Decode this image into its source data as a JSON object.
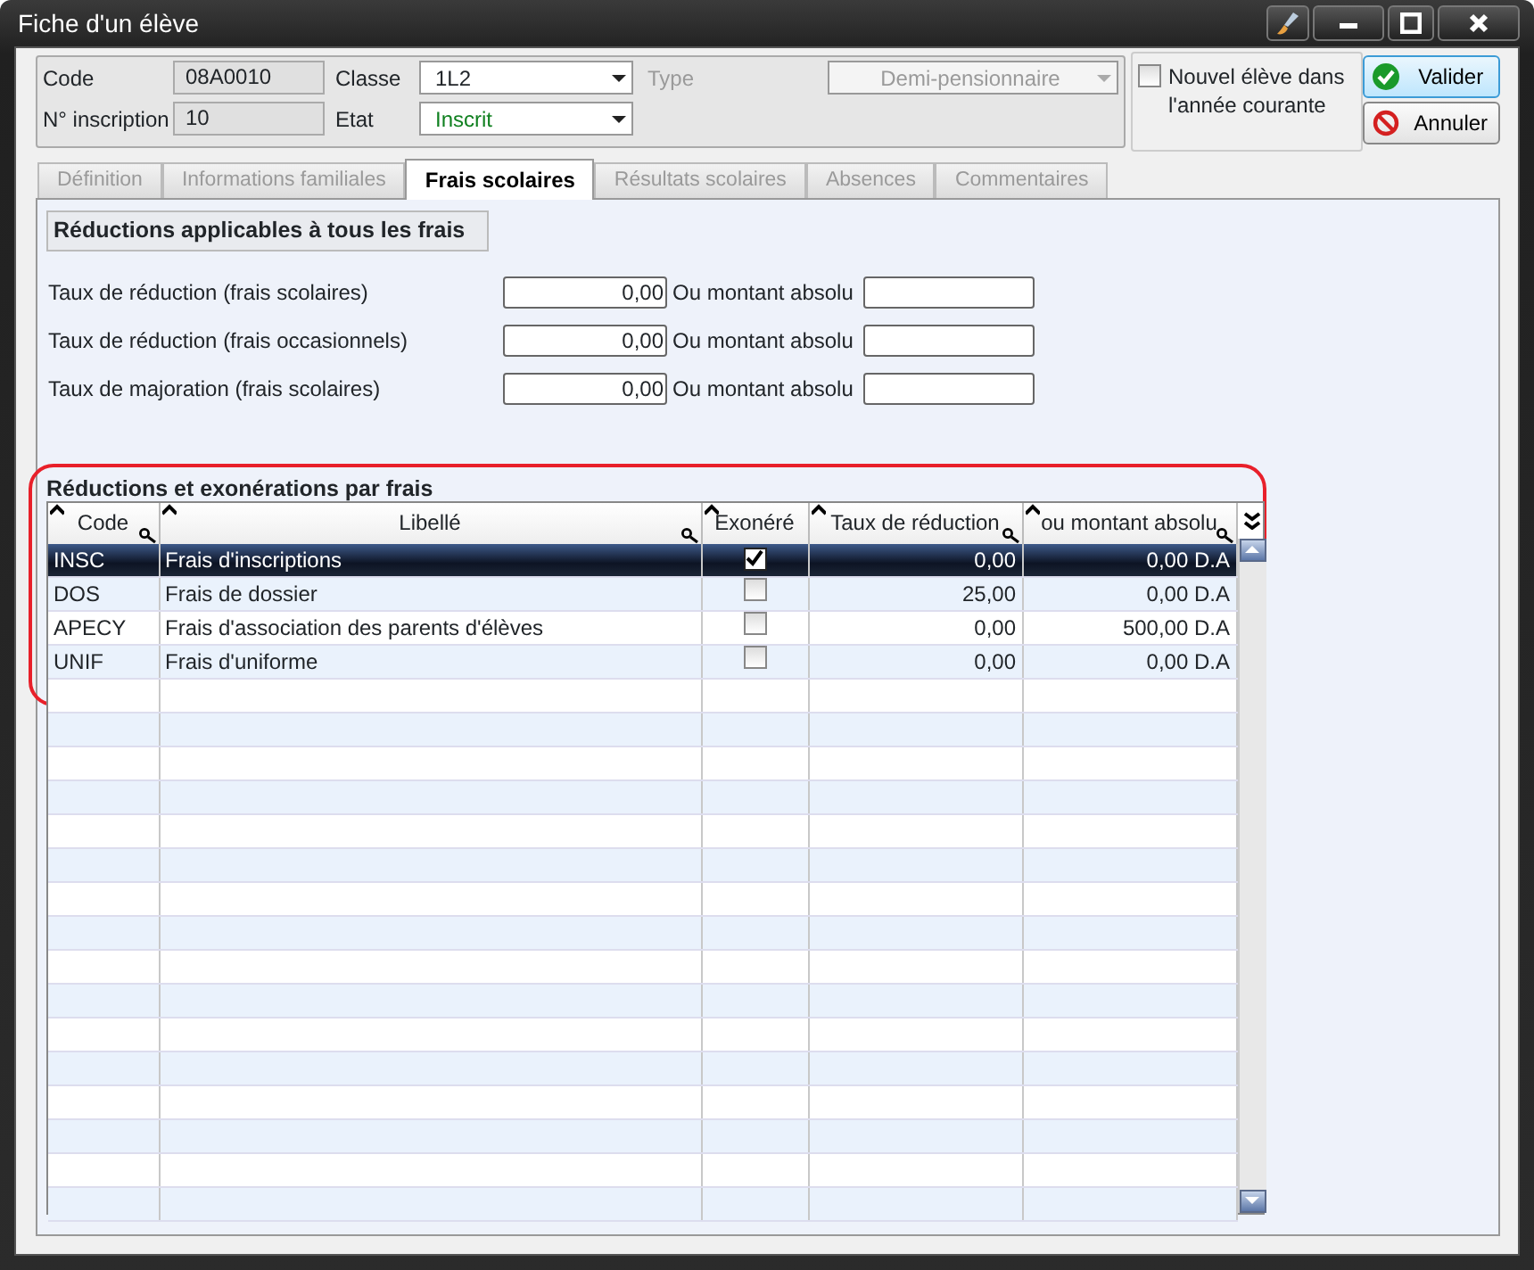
{
  "window": {
    "title": "Fiche d'un élève"
  },
  "header": {
    "code_label": "Code",
    "code": "08A0010",
    "inscription_label": "N° inscription",
    "inscription": "10",
    "classe_label": "Classe",
    "classe": "1L2",
    "etat_label": "Etat",
    "etat": "Inscrit",
    "type_label": "Type",
    "type": "Demi-pensionnaire",
    "type_disabled": true,
    "new_student": {
      "label": "Nouvel élève dans l'année courante",
      "checked": false
    }
  },
  "buttons": [
    {
      "kind": "ok",
      "label": "Valider"
    },
    {
      "kind": "cancel",
      "label": "Annuler"
    }
  ],
  "tabs": [
    {
      "label": "Définition",
      "selected": false
    },
    {
      "label": "Informations familiales",
      "selected": false
    },
    {
      "label": "Frais scolaires",
      "selected": true
    },
    {
      "label": "Résultats scolaires",
      "selected": false
    },
    {
      "label": "Absences",
      "selected": false
    },
    {
      "label": "Commentaires",
      "selected": false
    }
  ],
  "general": {
    "title": "Réductions applicables à tous les frais",
    "rows": [
      {
        "label": "Taux de réduction (frais scolaires)",
        "value": "0,00",
        "alt_label": "Ou montant absolu"
      },
      {
        "label": "Taux de réduction (frais occasionnels)",
        "value": "0,00",
        "alt_label": "Ou montant absolu"
      },
      {
        "label": "Taux de majoration (frais scolaires)",
        "value": "0,00",
        "alt_label": "Ou montant absolu"
      }
    ]
  },
  "per_fee": {
    "title": "Réductions et exonérations par frais",
    "columns": [
      "Code",
      "Libellé",
      "Exonéré",
      "Taux de réduction",
      "ou montant absolu"
    ],
    "rows": [
      {
        "code": "INSC",
        "label": "Frais d'inscriptions",
        "exonere": true,
        "taux": "0,00",
        "montant": "0,00 D.A",
        "selected": true
      },
      {
        "code": "DOS",
        "label": "Frais de dossier",
        "exonere": false,
        "taux": "25,00",
        "montant": "0,00 D.A",
        "selected": false
      },
      {
        "code": "APECY",
        "label": "Frais d'association des parents d'élèves",
        "exonere": false,
        "taux": "0,00",
        "montant": "500,00 D.A",
        "selected": false
      },
      {
        "code": "UNIF",
        "label": "Frais d'uniforme",
        "exonere": false,
        "taux": "0,00",
        "montant": "0,00 D.A",
        "selected": false
      }
    ]
  }
}
